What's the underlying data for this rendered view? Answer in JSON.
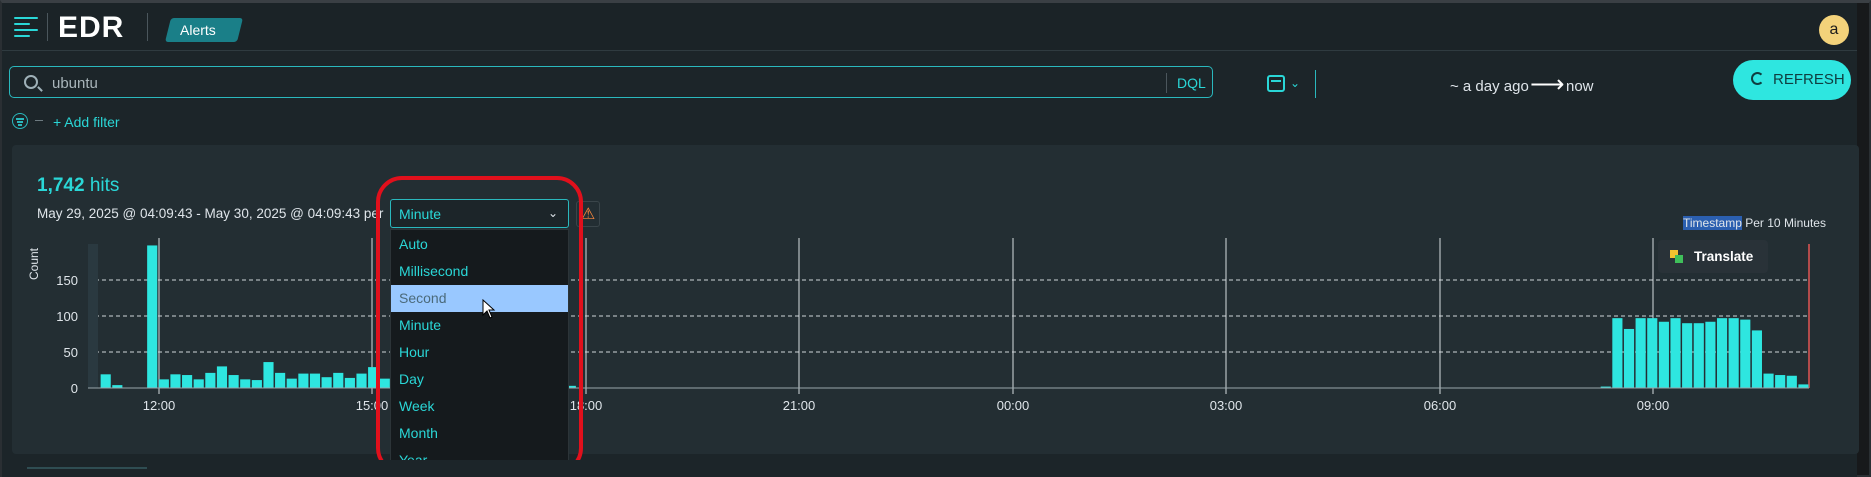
{
  "app": {
    "logo": "EDR",
    "breadcrumb": "Alerts",
    "avatar_initial": "a"
  },
  "search": {
    "value": "ubuntu",
    "dql_label": "DQL"
  },
  "date_range": {
    "start": "~ a day ago",
    "arrow": "⟶",
    "end": "now"
  },
  "refresh": {
    "label": "REFRESH"
  },
  "filter": {
    "add_label": "+ Add filter"
  },
  "summary": {
    "hits_count": "1,742",
    "hits_label": "hits",
    "range_text": "May 29, 2025 @ 04:09:43 - May 30, 2025 @ 04:09:43 per"
  },
  "interval_select": {
    "value": "Minute",
    "options": [
      "Auto",
      "Millisecond",
      "Second",
      "Minute",
      "Hour",
      "Day",
      "Week",
      "Month",
      "Year"
    ],
    "hovered": "Second"
  },
  "timestamp_label": {
    "field": "Timestamp",
    "rest": "Per 10 Minutes"
  },
  "translate": {
    "label": "Translate"
  },
  "colors": {
    "accent": "#2ad7d7",
    "bar": "#2ee6e0",
    "refresh_bg": "#2ee6e0",
    "highlight": "#e1101c"
  },
  "chart_data": {
    "type": "bar",
    "ylabel": "Count",
    "xlabel": "",
    "ylim": [
      0,
      200
    ],
    "y_ticks": [
      0,
      50,
      100,
      150
    ],
    "x_tick_labels": [
      "12:00",
      "15:00",
      "18:00",
      "21:00",
      "00:00",
      "03:00",
      "06:00",
      "09:00"
    ],
    "interval": "10 minutes",
    "series": [
      {
        "values": [
          0,
          19,
          4,
          0,
          0,
          198,
          12,
          19,
          18,
          12,
          21,
          30,
          18,
          12,
          11,
          36,
          21,
          13,
          20,
          20,
          15,
          21,
          14,
          20,
          29,
          13,
          22,
          15,
          0,
          0,
          0,
          0,
          0,
          0,
          0,
          0,
          0,
          0,
          0,
          0,
          5,
          3,
          0,
          0,
          0,
          0,
          0,
          0,
          0,
          0,
          0,
          0,
          0,
          0,
          0,
          0,
          0,
          0,
          0,
          0,
          0,
          0,
          0,
          0,
          0,
          0,
          0,
          0,
          0,
          0,
          0,
          0,
          0,
          0,
          0,
          0,
          0,
          0,
          0,
          0,
          0,
          0,
          0,
          0,
          0,
          0,
          0,
          0,
          0,
          0,
          0,
          0,
          0,
          0,
          0,
          0,
          0,
          0,
          0,
          0,
          0,
          0,
          0,
          0,
          0,
          0,
          0,
          0,
          0,
          0,
          0,
          0,
          0,
          0,
          0,
          0,
          0,
          0,
          0,
          0,
          0,
          0,
          0,
          0,
          0,
          0,
          0,
          0,
          0,
          0,
          2,
          97,
          82,
          97,
          97,
          92,
          97,
          90,
          90,
          92,
          97,
          97,
          95,
          80,
          20,
          18,
          17,
          5
        ]
      }
    ],
    "grid": "horizontal-dashed",
    "legend": "none"
  }
}
